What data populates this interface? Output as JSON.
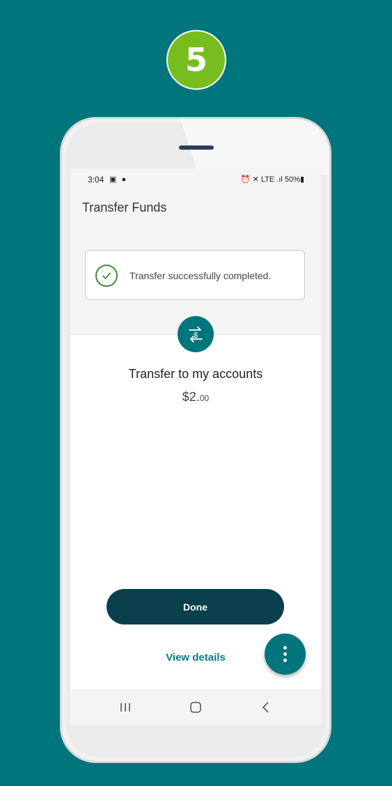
{
  "step": {
    "number": "5"
  },
  "status_bar": {
    "time": "3:04",
    "left_icons": "▣ ●",
    "right_text": "⏰ ✕ LTE .ıl 50%▮"
  },
  "header": {
    "title": "Transfer Funds"
  },
  "alert": {
    "message": "Transfer successfully completed."
  },
  "transfer": {
    "title": "Transfer to my accounts",
    "amount_main": "$2.",
    "amount_cents": "00"
  },
  "actions": {
    "done_label": "Done",
    "view_details_label": "View details"
  },
  "nav": {
    "recents_icon": "recents-icon",
    "home_icon": "home-icon",
    "back_icon": "back-icon"
  },
  "colors": {
    "background": "#00757c",
    "badge": "#78bd20",
    "done_button": "#0a3f4d",
    "link": "#0b7d86",
    "success": "#3f8a3a"
  }
}
